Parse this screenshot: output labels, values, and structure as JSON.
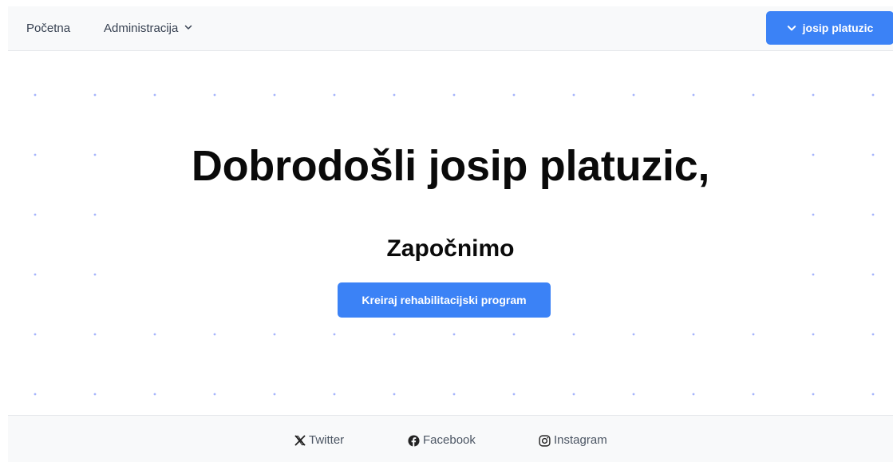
{
  "navbar": {
    "home_label": "Početna",
    "admin_label": "Administracija",
    "user_label": "josip platuzic"
  },
  "hero": {
    "title": "Dobrodošli josip platuzic,",
    "subtitle": "Započnimo",
    "cta_label": "Kreiraj rehabilitacijski program"
  },
  "footer": {
    "links": [
      {
        "label": "Twitter",
        "icon": "x-twitter-icon"
      },
      {
        "label": "Facebook",
        "icon": "facebook-icon"
      },
      {
        "label": "Instagram",
        "icon": "instagram-icon"
      }
    ]
  },
  "colors": {
    "accent": "#3b82f6",
    "dot": "#a5b4fc",
    "bar_bg": "#f8f9fa"
  }
}
